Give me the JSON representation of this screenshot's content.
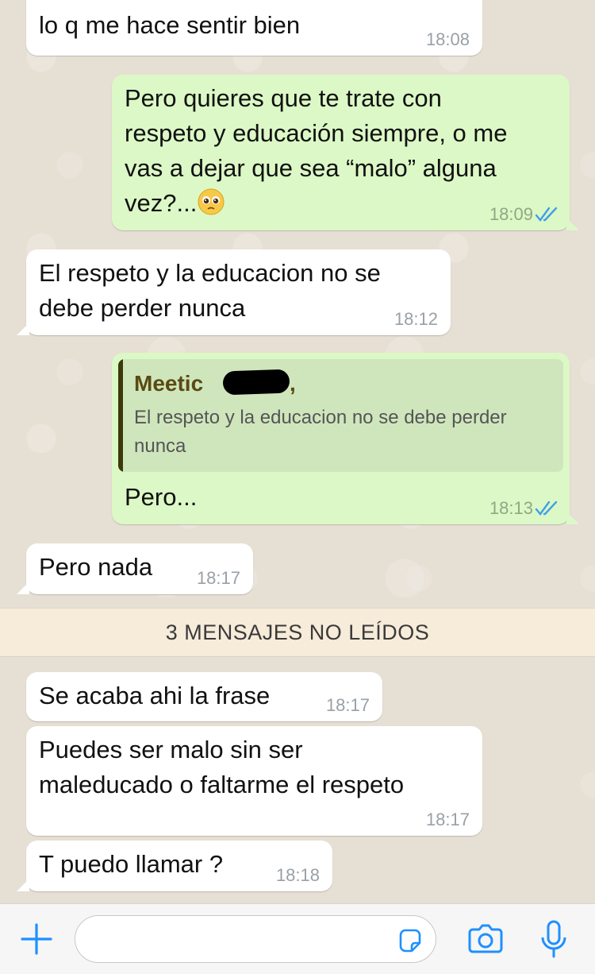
{
  "colors": {
    "incoming_bubble": "#ffffff",
    "outgoing_bubble": "#dcf8c6",
    "read_ticks": "#3fa0e8",
    "accent": "#1e90ff",
    "unread_banner": "#f7ebd9"
  },
  "messages": [
    {
      "id": "m1",
      "direction": "incoming",
      "text": "lo q me hace sentir bien",
      "time": "18:08"
    },
    {
      "id": "m2",
      "direction": "outgoing",
      "text": "Pero quieres que te trate con\nrespeto y educación siempre, o me\nvas a dejar que sea “malo” alguna\nvez?...",
      "emoji": "pleading-face-emoji",
      "time": "18:09",
      "status": "read"
    },
    {
      "id": "m3",
      "direction": "incoming",
      "text": "El respeto y la educacion no se\ndebe perder nunca",
      "time": "18:12"
    },
    {
      "id": "m4",
      "direction": "outgoing",
      "quote": {
        "author": "Meetic",
        "author_suffix": ",",
        "text": "El respeto y la educacion no se debe perder nunca"
      },
      "text": "Pero...",
      "time": "18:13",
      "status": "read"
    },
    {
      "id": "m5",
      "direction": "incoming",
      "text": "Pero nada",
      "time": "18:17"
    },
    {
      "id": "m6",
      "direction": "incoming",
      "text": "Se acaba ahi la frase",
      "time": "18:17"
    },
    {
      "id": "m7",
      "direction": "incoming",
      "text": "Puedes ser malo sin ser\nmaleducado o faltarme el respeto",
      "time": "18:17"
    },
    {
      "id": "m8",
      "direction": "incoming",
      "text": "T puedo llamar ?",
      "time": "18:18"
    }
  ],
  "unread_banner": {
    "label": "3 MENSAJES NO LEÍDOS"
  },
  "input_bar": {
    "placeholder": "",
    "value": "",
    "icons": [
      "plus-icon",
      "sticker-icon",
      "camera-icon",
      "microphone-icon"
    ]
  }
}
